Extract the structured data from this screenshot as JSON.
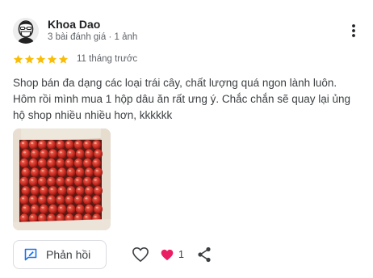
{
  "reviewer": {
    "name": "Khoa Dao",
    "meta": "3 bài đánh giá · 1 ảnh",
    "avatar_icon": "masked-face-avatar"
  },
  "review": {
    "rating": 5,
    "max_rating": 5,
    "age": "11 tháng trước",
    "text": "Shop bán đa dạng các loại trái cây, chất lượng quá ngon lành luôn. Hôm rồi mình mua 1 hộp dâu ăn rất ưng ý. Chắc chắn sẽ quay lại ủng hộ shop nhiều nhiều hơn, kkkkkk",
    "photo_subject": "box-of-strawberries"
  },
  "actions": {
    "reply_label": "Phản hồi",
    "reaction_count": "1",
    "icons": [
      "more-vert-icon",
      "reply-icon",
      "like-heart-icon",
      "heart-reaction-icon",
      "share-icon"
    ]
  },
  "colors": {
    "star": "#fbbc04",
    "reaction_heart": "#e91e63",
    "reply_icon": "#1a73e8"
  }
}
